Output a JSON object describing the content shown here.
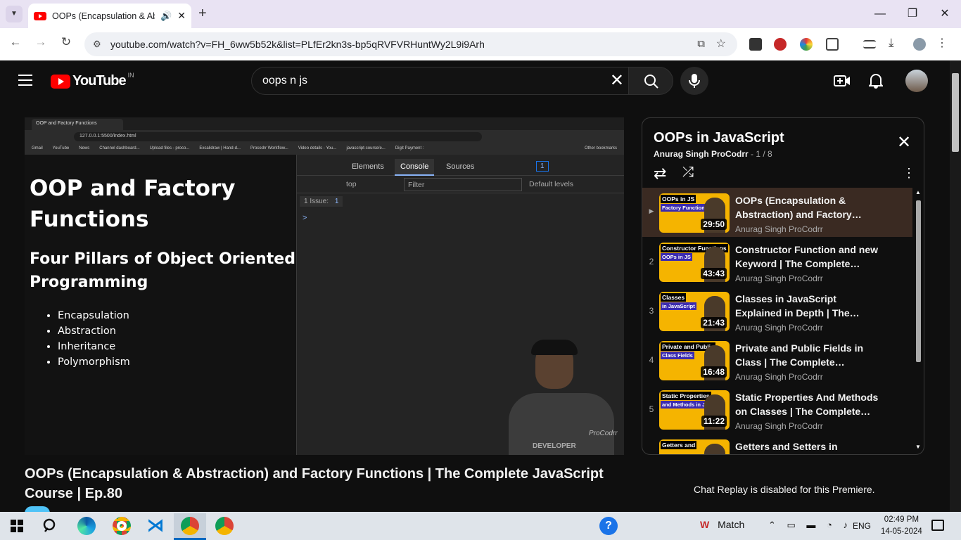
{
  "browser": {
    "tab_title": "OOPs (Encapsulation & Abs",
    "url": "youtube.com/watch?v=FH_6ww5b52k&list=PLfEr2kn3s-bp5qRVFVRHuntWy2L9i9Arh"
  },
  "youtube": {
    "logo_text": "YouTube",
    "region": "IN",
    "search_value": "oops n js"
  },
  "video": {
    "inner": {
      "tab_title": "OOP and Factory Functions",
      "url": "127.0.0.1:5500/index.html",
      "bookmarks": [
        "Gmail",
        "YouTube",
        "News",
        "Channel dashboard...",
        "Upload files - proco...",
        "Excalidraw | Hand-d...",
        "Procodrr Workflow...",
        "Video details - You...",
        "javascript-course/e...",
        "Digit Payment :",
        "Other bookmarks"
      ],
      "heading1": "OOP and Factory Functions",
      "heading2": "Four Pillars of Object Oriented Programming",
      "pillars": [
        "Encapsulation",
        "Abstraction",
        "Inheritance",
        "Polymorphism"
      ],
      "devtools_tabs": [
        "Elements",
        "Console",
        "Sources"
      ],
      "devtools_badge": "1",
      "context": "top",
      "filter_placeholder": "Filter",
      "levels": "Default levels",
      "issues": "1 Issue:",
      "issues_count": "1",
      "prompt": ">",
      "watermark": "ProCodrr",
      "shirt": "DEVELOPER"
    },
    "title": "OOPs (Encapsulation & Abstraction) and Factory Functions | The Complete JavaScript Course | Ep.80"
  },
  "playlist": {
    "title": "OOPs in JavaScript",
    "owner": "Anurag Singh ProCodrr",
    "position": "- 1 / 8",
    "items": [
      {
        "index": "▶",
        "label": "OOPs in JS",
        "label2": "Factory Functions",
        "duration": "29:50",
        "name": "OOPs (Encapsulation & Abstraction) and Factory…",
        "channel": "Anurag Singh ProCodrr"
      },
      {
        "index": "2",
        "label": "Constructor Functions",
        "label2": "OOPs in JS",
        "duration": "43:43",
        "name": "Constructor Function and new Keyword | The Complete…",
        "channel": "Anurag Singh ProCodrr"
      },
      {
        "index": "3",
        "label": "Classes",
        "label2": "in JavaScript",
        "duration": "21:43",
        "name": "Classes in JavaScript Explained in Depth | The…",
        "channel": "Anurag Singh ProCodrr"
      },
      {
        "index": "4",
        "label": "Private and Public",
        "label2": "Class Fields",
        "duration": "16:48",
        "name": "Private and Public Fields in Class | The Complete…",
        "channel": "Anurag Singh ProCodrr"
      },
      {
        "index": "5",
        "label": "Static Properties",
        "label2": "and Methods in JS",
        "duration": "11:22",
        "name": "Static Properties And Methods on Classes | The Complete…",
        "channel": "Anurag Singh ProCodrr"
      },
      {
        "index": "",
        "label": "Getters and",
        "label2": "",
        "duration": "",
        "name": "Getters and Setters in",
        "channel": ""
      }
    ]
  },
  "chat": {
    "message": "Chat Replay is disabled for this Premiere."
  },
  "taskbar": {
    "match_label": "Match",
    "language": "ENG",
    "time": "02:49 PM",
    "date": "14-05-2024"
  },
  "colors": {
    "youtube_red": "#ff0000",
    "accent_yellow": "#f5b400",
    "active_row": "#3a2a22"
  }
}
